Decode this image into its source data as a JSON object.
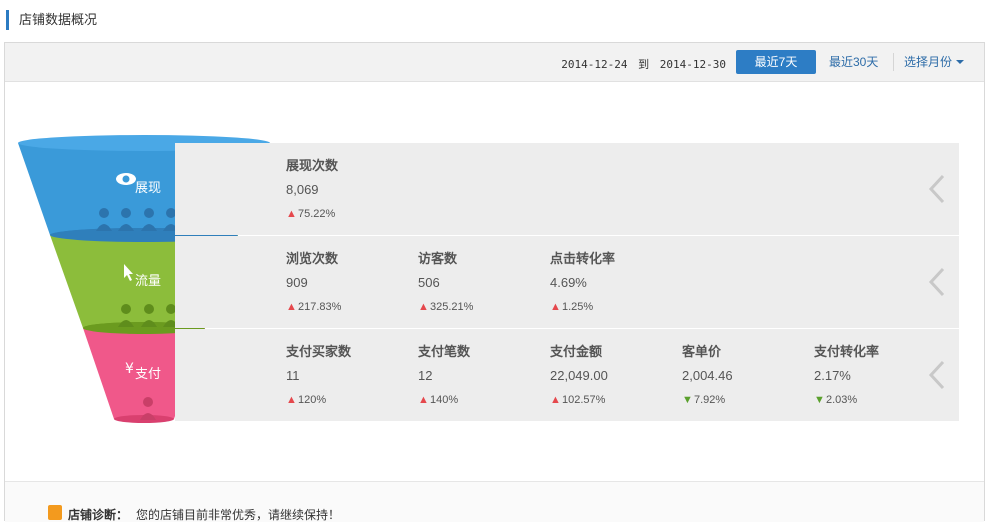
{
  "page": {
    "title": "店铺数据概况"
  },
  "toolbar": {
    "date_from": "2014-12-24",
    "date_sep": "到",
    "date_to": "2014-12-30",
    "btn_7d": "最近7天",
    "btn_30d": "最近30天",
    "btn_month": "选择月份"
  },
  "funnel": {
    "stages": [
      {
        "label": "展现",
        "color": "#3a9ad9",
        "icon": "eye-icon"
      },
      {
        "label": "流量",
        "color": "#8cbd3b",
        "icon": "cursor-icon"
      },
      {
        "label": "支付",
        "color": "#f0588a",
        "icon": "yen-icon"
      }
    ]
  },
  "rows": [
    {
      "metrics": [
        {
          "label": "展现次数",
          "value": "8,069",
          "change": "75.22%",
          "dir": "up"
        }
      ]
    },
    {
      "metrics": [
        {
          "label": "浏览次数",
          "value": "909",
          "change": "217.83%",
          "dir": "up"
        },
        {
          "label": "访客数",
          "value": "506",
          "change": "325.21%",
          "dir": "up"
        },
        {
          "label": "点击转化率",
          "value": "4.69%",
          "change": "1.25%",
          "dir": "up"
        }
      ]
    },
    {
      "metrics": [
        {
          "label": "支付买家数",
          "value": "11",
          "change": "120%",
          "dir": "up"
        },
        {
          "label": "支付笔数",
          "value": "12",
          "change": "140%",
          "dir": "up"
        },
        {
          "label": "支付金额",
          "value": "22,049.00",
          "change": "102.57%",
          "dir": "up"
        },
        {
          "label": "客单价",
          "value": "2,004.46",
          "change": "7.92%",
          "dir": "down"
        },
        {
          "label": "支付转化率",
          "value": "2.17%",
          "change": "2.03%",
          "dir": "down"
        }
      ]
    }
  ],
  "diagnosis": {
    "title": "店铺诊断：",
    "text": "您的店铺目前非常优秀，请继续保持！"
  },
  "colors": {
    "accent": "#2d7dc5",
    "up": "#e5484d",
    "down": "#5aa02c"
  }
}
